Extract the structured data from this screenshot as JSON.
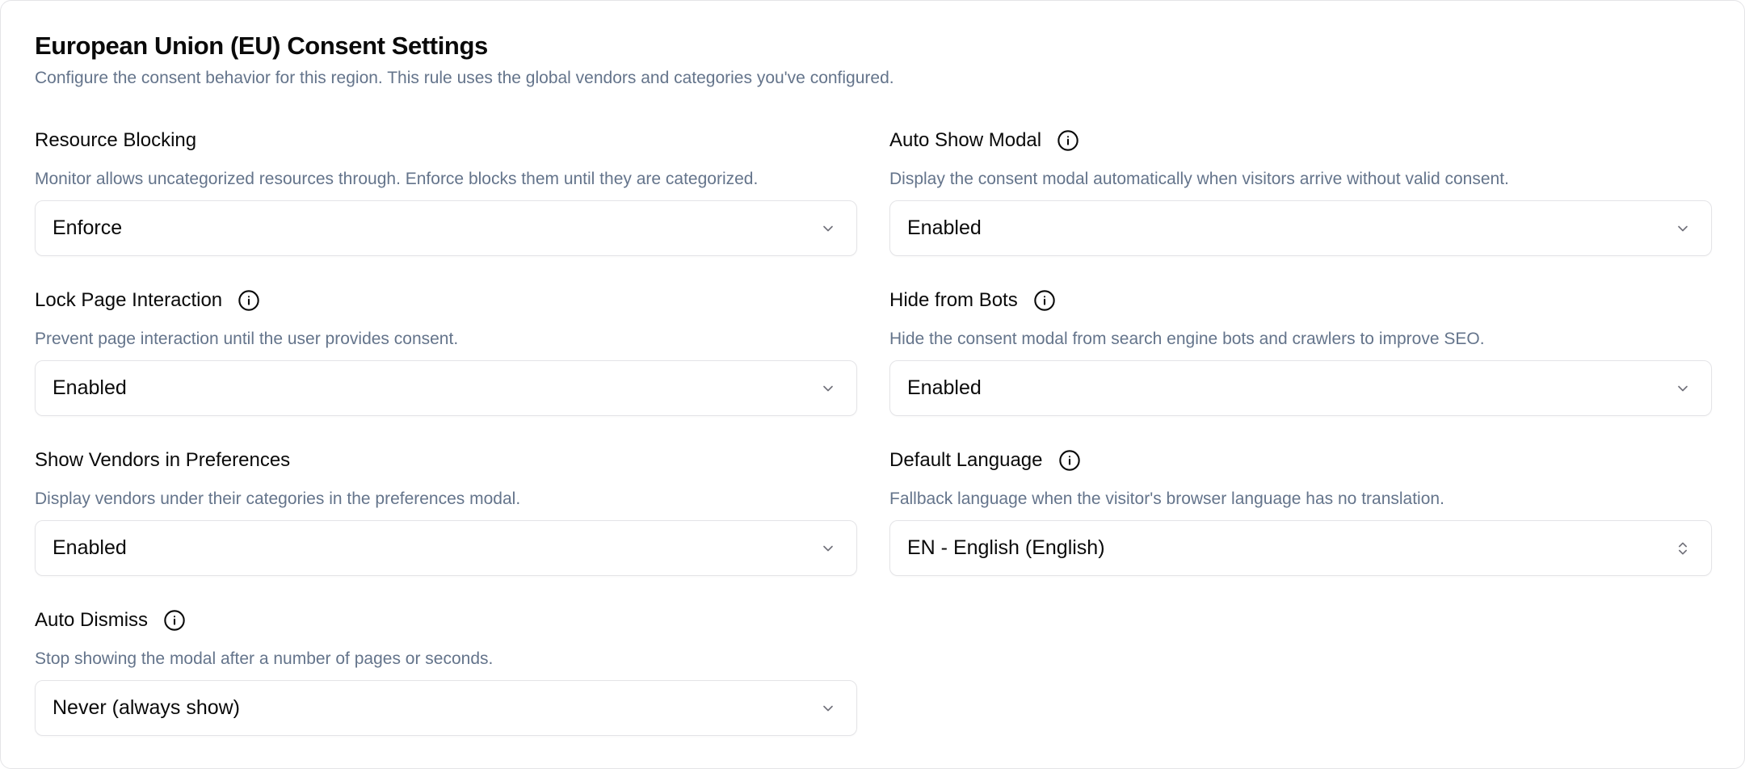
{
  "header": {
    "title": "European Union (EU) Consent Settings",
    "subtitle": "Configure the consent behavior for this region. This rule uses the global vendors and categories you've configured."
  },
  "fields": {
    "resource_blocking": {
      "label": "Resource Blocking",
      "description": "Monitor allows uncategorized resources through. Enforce blocks them until they are categorized.",
      "value": "Enforce",
      "icon": "chevron-down-icon"
    },
    "auto_show_modal": {
      "label": "Auto Show Modal",
      "description": "Display the consent modal automatically when visitors arrive without valid consent.",
      "value": "Enabled",
      "icon": "chevron-down-icon"
    },
    "lock_page_interaction": {
      "label": "Lock Page Interaction",
      "description": "Prevent page interaction until the user provides consent.",
      "value": "Enabled",
      "icon": "chevron-down-icon"
    },
    "hide_from_bots": {
      "label": "Hide from Bots",
      "description": "Hide the consent modal from search engine bots and crawlers to improve SEO.",
      "value": "Enabled",
      "icon": "chevron-down-icon"
    },
    "show_vendors": {
      "label": "Show Vendors in Preferences",
      "description": "Display vendors under their categories in the preferences modal.",
      "value": "Enabled",
      "icon": "chevron-down-icon"
    },
    "default_language": {
      "label": "Default Language",
      "description": "Fallback language when the visitor's browser language has no translation.",
      "value": "EN - English (English)",
      "icon": "chevrons-up-down-icon"
    },
    "auto_dismiss": {
      "label": "Auto Dismiss",
      "description": "Stop showing the modal after a number of pages or seconds.",
      "value": "Never (always show)",
      "icon": "chevron-down-icon"
    }
  },
  "colors": {
    "text": "#0a0a0a",
    "muted": "#64748b",
    "border": "#e4e4e7"
  }
}
